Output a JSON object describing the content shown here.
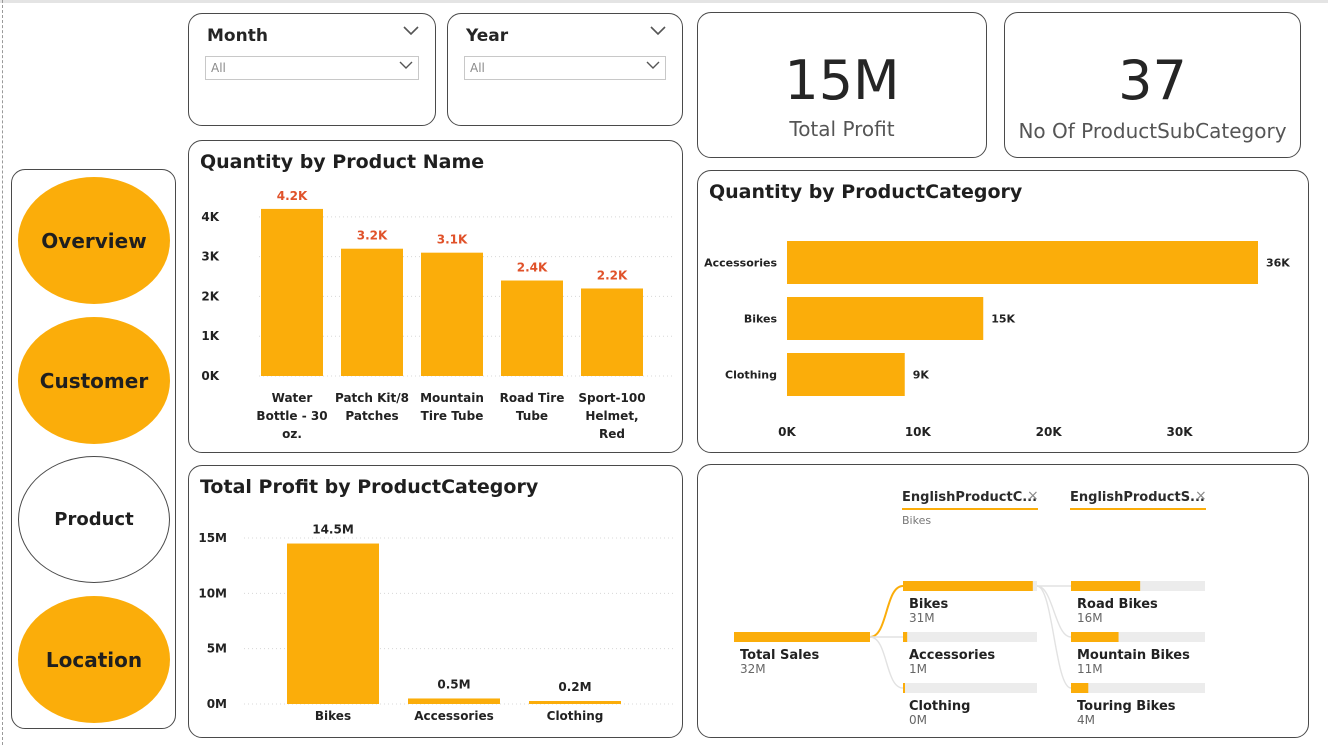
{
  "nav": {
    "overview": "Overview",
    "customer": "Customer",
    "product": "Product",
    "location": "Location"
  },
  "slicers": {
    "month": {
      "title": "Month",
      "value": "All"
    },
    "year": {
      "title": "Year",
      "value": "All"
    }
  },
  "kpis": {
    "total_profit": {
      "value": "15M",
      "label": "Total Profit"
    },
    "subcategory_count": {
      "value": "37",
      "label": "No Of ProductSubCategory"
    }
  },
  "colors": {
    "accent": "#fbad0a",
    "data_label": "#e0522a",
    "track": "#ececec"
  },
  "chart_data": [
    {
      "id": "qty_by_product",
      "type": "bar",
      "title": "Quantity by Product Name",
      "categories": [
        "Water Bottle - 30 oz.",
        "Patch Kit/8 Patches",
        "Mountain Tire Tube",
        "Road Tire Tube",
        "Sport-100 Helmet, Red"
      ],
      "category_lines": [
        [
          "Water",
          "Bottle - 30",
          "oz."
        ],
        [
          "Patch Kit/8",
          "Patches"
        ],
        [
          "Mountain",
          "Tire Tube"
        ],
        [
          "Road Tire",
          "Tube"
        ],
        [
          "Sport-100",
          "Helmet,",
          "Red"
        ]
      ],
      "values": [
        4200,
        3200,
        3100,
        2400,
        2200
      ],
      "data_labels": [
        "4.2K",
        "3.2K",
        "3.1K",
        "2.4K",
        "2.2K"
      ],
      "yticks": [
        "0K",
        "1K",
        "2K",
        "3K",
        "4K"
      ],
      "ytick_values": [
        0,
        1000,
        2000,
        3000,
        4000
      ],
      "ylim": [
        0,
        4600
      ],
      "grid": true
    },
    {
      "id": "qty_by_category",
      "type": "bar",
      "orientation": "horizontal",
      "title": "Quantity by ProductCategory",
      "categories": [
        "Accessories",
        "Bikes",
        "Clothing"
      ],
      "values": [
        36000,
        15000,
        9000
      ],
      "data_labels": [
        "36K",
        "15K",
        "9K"
      ],
      "xticks": [
        "0K",
        "10K",
        "20K",
        "30K"
      ],
      "xtick_values": [
        0,
        10000,
        20000,
        30000
      ],
      "xlim": [
        0,
        36000
      ],
      "grid": false
    },
    {
      "id": "profit_by_category",
      "type": "bar",
      "title": "Total Profit by ProductCategory",
      "categories": [
        "Bikes",
        "Accessories",
        "Clothing"
      ],
      "values": [
        14.5,
        0.5,
        0.2
      ],
      "data_labels": [
        "14.5M",
        "0.5M",
        "0.2M"
      ],
      "yticks": [
        "0M",
        "5M",
        "10M",
        "15M"
      ],
      "ytick_values": [
        0,
        5,
        10,
        15
      ],
      "ylim": [
        0,
        15
      ],
      "grid": true
    }
  ],
  "decomp_tree": {
    "headers": [
      {
        "label": "EnglishProductC...",
        "filter": "Bikes"
      },
      {
        "label": "EnglishProductS..."
      }
    ],
    "close_glyph": "×",
    "root": {
      "label": "Total Sales",
      "value": "32M",
      "amount": 32
    },
    "level1": [
      {
        "label": "Bikes",
        "value": "31M",
        "amount": 31
      },
      {
        "label": "Accessories",
        "value": "1M",
        "amount": 1
      },
      {
        "label": "Clothing",
        "value": "0M",
        "amount": 0.2
      }
    ],
    "level2": [
      {
        "label": "Road Bikes",
        "value": "16M",
        "amount": 16
      },
      {
        "label": "Mountain Bikes",
        "value": "11M",
        "amount": 11
      },
      {
        "label": "Touring Bikes",
        "value": "4M",
        "amount": 4
      }
    ]
  }
}
